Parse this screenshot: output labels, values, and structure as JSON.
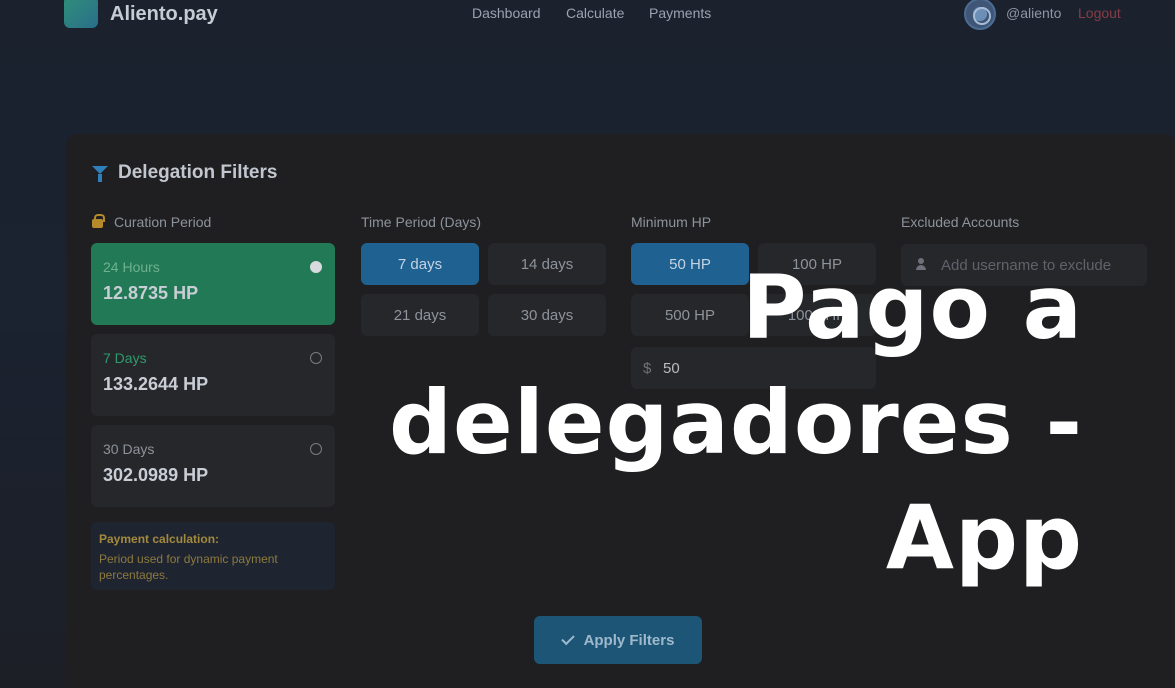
{
  "header": {
    "brand": "Aliento.pay",
    "nav": [
      "Dashboard",
      "Calculate",
      "Payments"
    ],
    "username": "@aliento",
    "logout": "Logout"
  },
  "filters": {
    "title": "Delegation Filters",
    "curation": {
      "label": "Curation Period",
      "options": [
        {
          "label": "24 Hours",
          "value": "12.8735 HP",
          "label_color": "#6fb08f",
          "selected": true
        },
        {
          "label": "7 Days",
          "value": "133.2644 HP",
          "label_color": "#2f9b6c",
          "selected": false
        },
        {
          "label": "30 Days",
          "value": "302.0989 HP",
          "label_color": "#8d939c",
          "selected": false
        }
      ],
      "note_title": "Payment calculation:",
      "note_text": "Period used for dynamic payment percentages."
    },
    "time_period": {
      "label": "Time Period (Days)",
      "options": [
        "7 days",
        "14 days",
        "21 days",
        "30 days"
      ],
      "selected": "7 days"
    },
    "min_hp": {
      "label": "Minimum HP",
      "options": [
        "50 HP",
        "100 HP",
        "500 HP",
        "1000 HP"
      ],
      "selected": "50 HP",
      "currency": "$",
      "custom_value": "50"
    },
    "excluded": {
      "label": "Excluded Accounts",
      "placeholder": "Add username to exclude"
    },
    "apply_label": "Apply Filters"
  },
  "overlay": {
    "line1": "Pago a",
    "line2": "delegadores -",
    "line3": "App"
  },
  "colors": {
    "accent_blue": "#1f6190",
    "accent_green": "#217a55",
    "logout_red": "#8a3b45"
  }
}
